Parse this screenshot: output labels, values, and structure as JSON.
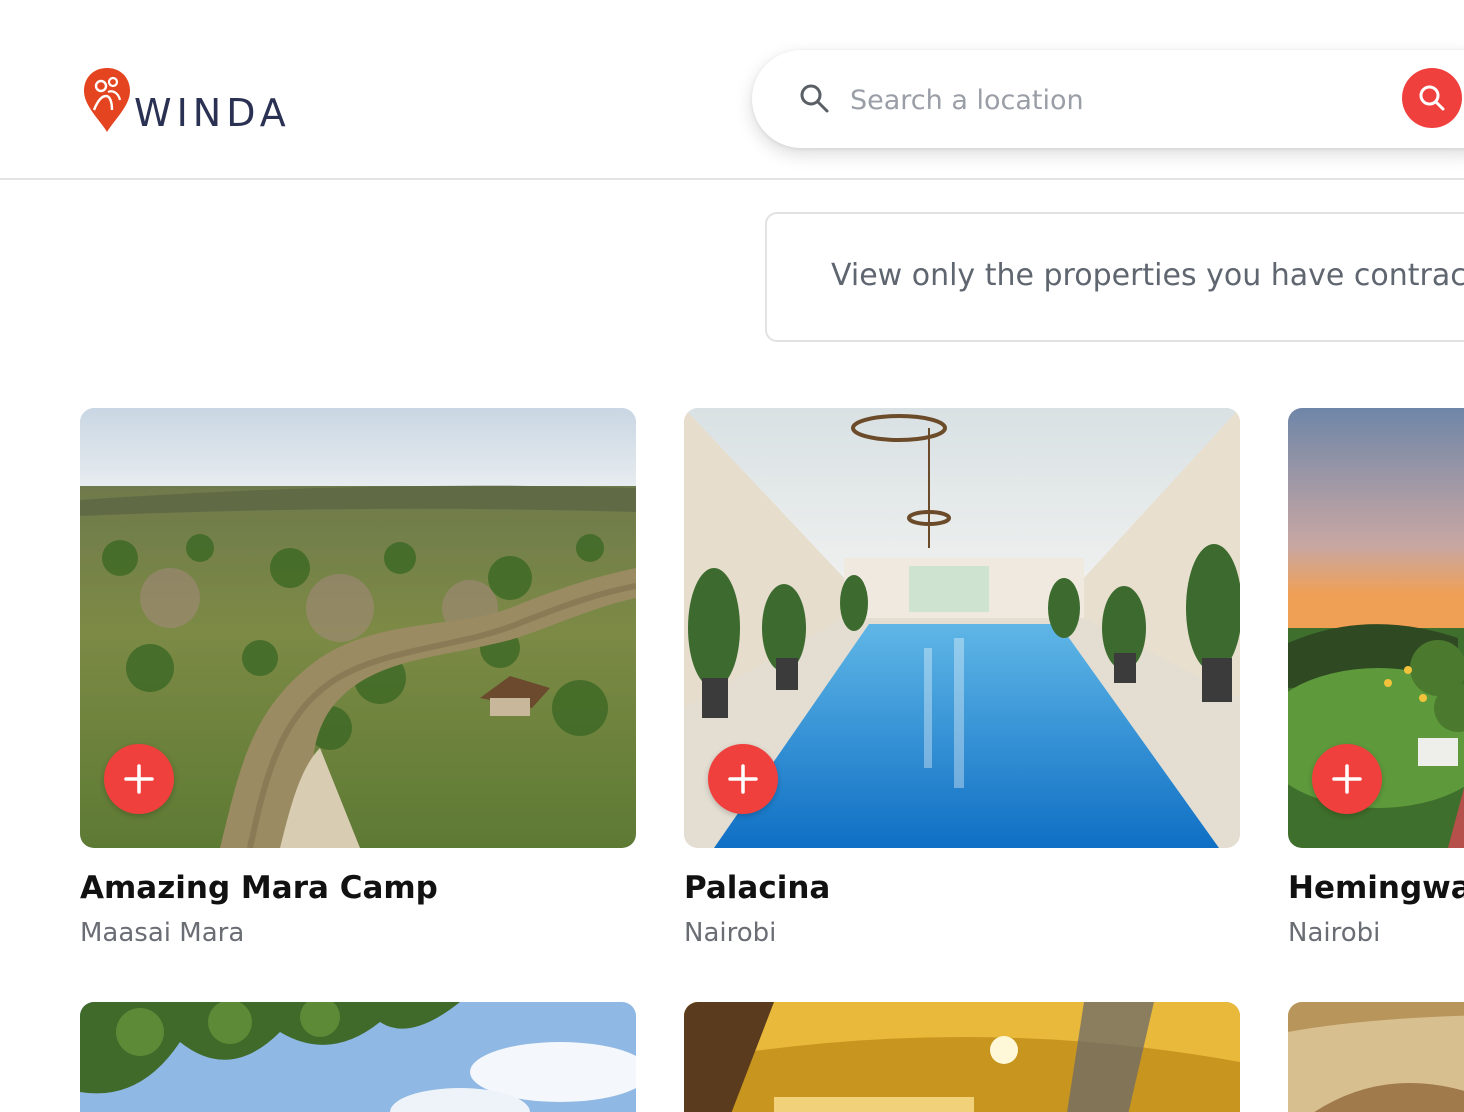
{
  "header": {
    "brand": "WINDA",
    "search": {
      "placeholder": "Search a location",
      "value": ""
    }
  },
  "filter": {
    "label": "View only the properties you have contract"
  },
  "properties": [
    {
      "name": "Amazing Mara Camp",
      "location": "Maasai Mara"
    },
    {
      "name": "Palacina",
      "location": "Nairobi"
    },
    {
      "name": "Hemingway",
      "location": "Nairobi"
    }
  ],
  "icons": {
    "brand_pin": "location-pin-icon",
    "search": "search-icon",
    "search_button": "search-icon",
    "add": "plus-icon"
  },
  "colors": {
    "accent": "#f0403d",
    "brand_text": "#2b3152",
    "muted_text": "#6a6e74"
  }
}
